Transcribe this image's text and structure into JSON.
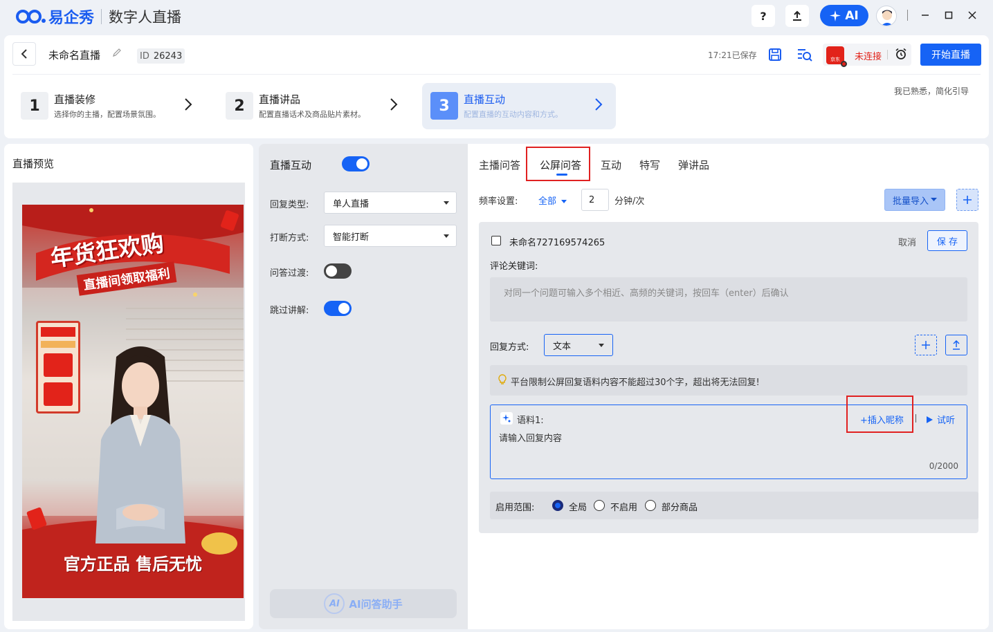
{
  "titlebar": {
    "brand": "易企秀",
    "product": "数字人直播",
    "help_label": "?",
    "ai_label": "AI"
  },
  "header": {
    "live_name": "未命名直播",
    "id_label": "ID",
    "id_value": "26243",
    "saved_status": "17:21已保存",
    "platform": "京东",
    "connection_status": "未连接",
    "start_button": "开始直播",
    "familiar_link": "我已熟悉，简化引导",
    "steps": [
      {
        "num": "1",
        "title": "直播装修",
        "desc": "选择你的主播，配置场景氛围。"
      },
      {
        "num": "2",
        "title": "直播讲品",
        "desc": "配置直播话术及商品贴片素材。"
      },
      {
        "num": "3",
        "title": "直播互动",
        "desc": "配置直播的互动内容和方式。"
      }
    ]
  },
  "preview": {
    "title": "直播预览",
    "poster_title": "年货狂欢购",
    "poster_subtitle": "直播间领取福利",
    "poster_bottom": "官方正品 售后无忧"
  },
  "settings": {
    "title": "直播互动",
    "title_toggle_on": true,
    "reply_type_label": "回复类型:",
    "reply_type_value": "单人直播",
    "interrupt_label": "打断方式:",
    "interrupt_value": "智能打断",
    "transition_label": "问答过渡:",
    "transition_on": false,
    "skip_label": "跳过讲解:",
    "skip_on": true,
    "ai_assistant_label": "AI问答助手",
    "ai_badge": "AI"
  },
  "right": {
    "tabs": [
      "主播问答",
      "公屏问答",
      "互动",
      "特写",
      "弹讲品"
    ],
    "active_tab": 1,
    "freq_label": "频率设置:",
    "freq_value": "全部",
    "freq_number": "2",
    "freq_unit": "分钟/次",
    "bulk_import": "批量导入",
    "qa": {
      "name": "未命名727169574265",
      "cancel": "取消",
      "save": "保 存",
      "keyword_label": "评论关键词:",
      "keyword_placeholder": "对同一个问题可输入多个相近、高频的关键词，按回车（enter）后确认",
      "reply_mode_label": "回复方式:",
      "reply_mode_value": "文本",
      "tip": "平台限制公屏回复语料内容不能超过30个字，超出将无法回复!",
      "corpus_label": "语料1:",
      "insert_nickname": "+插入昵称",
      "try_listen": "试听",
      "corpus_placeholder": "请输入回复内容",
      "corpus_count": "0/2000",
      "scope_label": "启用范围:",
      "scope_options": [
        "全局",
        "不启用",
        "部分商品"
      ],
      "scope_selected": 0
    }
  },
  "colors": {
    "accent": "#1663f5",
    "highlight": "#e02020"
  }
}
